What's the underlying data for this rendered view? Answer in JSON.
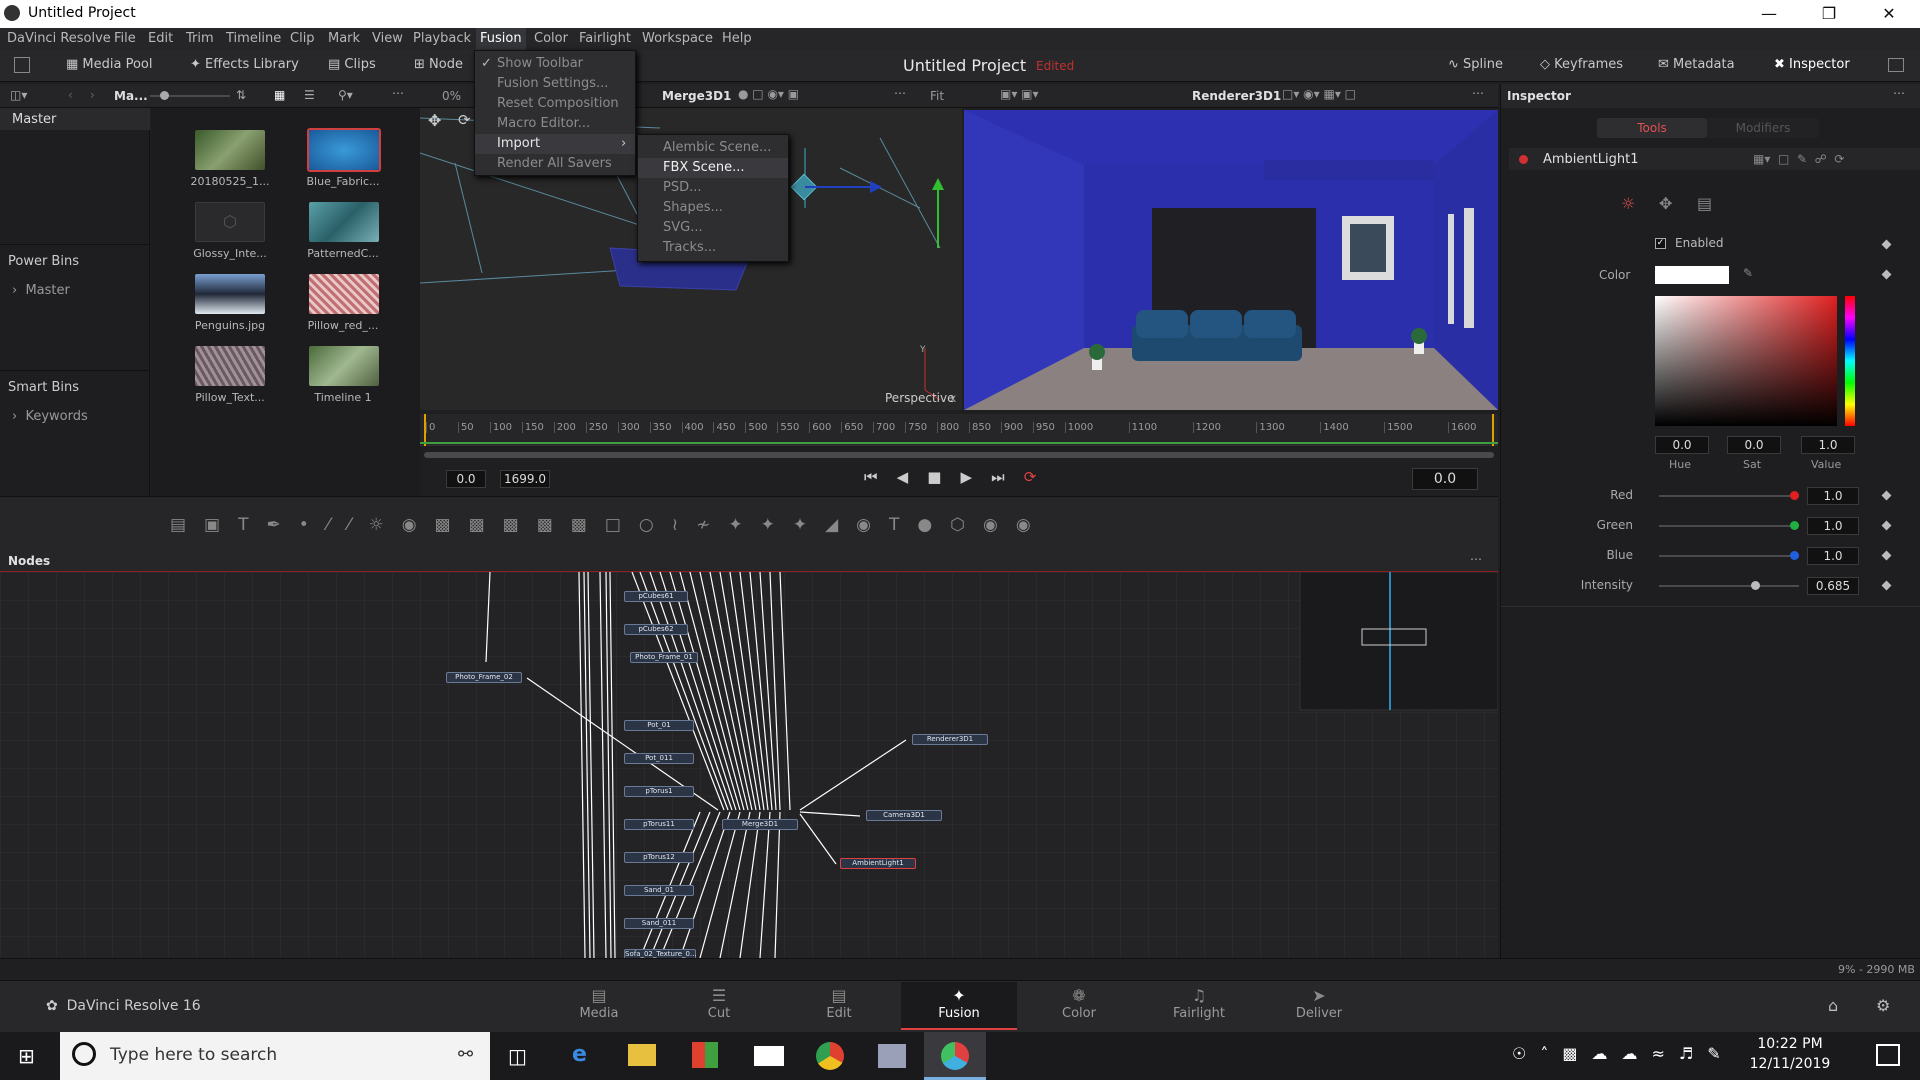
{
  "window": {
    "title": "Untitled Project"
  },
  "menubar": [
    "DaVinci Resolve",
    "File",
    "Edit",
    "Trim",
    "Timeline",
    "Clip",
    "Mark",
    "View",
    "Playback",
    "Fusion",
    "Color",
    "Fairlight",
    "Workspace",
    "Help"
  ],
  "toolbar": {
    "media_pool": "Media Pool",
    "effects_library": "Effects Library",
    "clips": "Clips",
    "nodes": "Node",
    "project_title": "Untitled Project",
    "edited": "Edited",
    "spline": "Spline",
    "keyframes": "Keyframes",
    "metadata": "Metadata",
    "inspector": "Inspector"
  },
  "fusion_menu": {
    "items": [
      "Show Toolbar",
      "Fusion Settings...",
      "Reset Composition",
      "Macro Editor...",
      "Import",
      "Render All Savers"
    ],
    "checked": "Show Toolbar"
  },
  "import_submenu": {
    "items": [
      "Alembic Scene...",
      "FBX Scene...",
      "PSD...",
      "Shapes...",
      "SVG...",
      "Tracks..."
    ],
    "highlighted": "FBX Scene..."
  },
  "media_pool": {
    "header": "Ma...",
    "bins": {
      "master": "Master",
      "power_bins": "Power Bins",
      "power_master": "Master",
      "smart_bins": "Smart Bins",
      "keywords": "Keywords"
    },
    "clips": [
      "20180525_1...",
      "Blue_Fabric...",
      "Glossy_Inte...",
      "PatternedC...",
      "Penguins.jpg",
      "Pillow_red_...",
      "Pillow_Text...",
      "Timeline 1"
    ]
  },
  "viewer_left": {
    "zoom": "0%",
    "node": "Merge3D1",
    "fit": "Fit",
    "label": "Perspective",
    "axis_y": "Y",
    "axis_x": "X"
  },
  "viewer_right": {
    "node": "Renderer3D1"
  },
  "ruler": [
    "0",
    "50",
    "100",
    "150",
    "200",
    "250",
    "300",
    "350",
    "400",
    "450",
    "500",
    "550",
    "600",
    "650",
    "700",
    "750",
    "800",
    "850",
    "900",
    "950",
    "1000",
    "1100",
    "1200",
    "1300",
    "1400",
    "1500",
    "1600"
  ],
  "transport": {
    "start": "0.0",
    "end": "1699.0",
    "current": "0.0"
  },
  "nodes_panel": {
    "title": "Nodes",
    "nodes": [
      "pCubes61",
      "pCubes62",
      "Photo_Frame_01",
      "Photo_Frame_02",
      "Pot_01",
      "Pot_011",
      "pTorus1",
      "pTorus11",
      "pTorus12",
      "Sand_01",
      "Sand_011",
      "Sofa_02_Texture_0...",
      "Merge3D1",
      "Renderer3D1",
      "Camera3D1",
      "AmbientLight1"
    ]
  },
  "inspector": {
    "title": "Inspector",
    "tab_tools": "Tools",
    "tab_modifiers": "Modifiers",
    "tool_name": "AmbientLight1",
    "enabled": "Enabled",
    "color_label": "Color",
    "hue": "0.0",
    "sat": "0.0",
    "value": "1.0",
    "hue_label": "Hue",
    "sat_label": "Sat",
    "value_label": "Value",
    "red_label": "Red",
    "red": "1.0",
    "green_label": "Green",
    "green": "1.0",
    "blue_label": "Blue",
    "blue": "1.0",
    "intensity_label": "Intensity",
    "intensity": "0.685",
    "intensity_level": 0.685,
    "colors": {
      "red": "#e02020",
      "green": "#20b040",
      "blue": "#2060e0"
    }
  },
  "status": {
    "memory": "9% - 2990 MB"
  },
  "app_footer": {
    "name": "DaVinci Resolve 16"
  },
  "pages": [
    "Media",
    "Cut",
    "Edit",
    "Fusion",
    "Color",
    "Fairlight",
    "Deliver"
  ],
  "active_page": "Fusion",
  "taskbar": {
    "search_placeholder": "Type here to search",
    "time": "10:22 PM",
    "date": "12/11/2019"
  }
}
